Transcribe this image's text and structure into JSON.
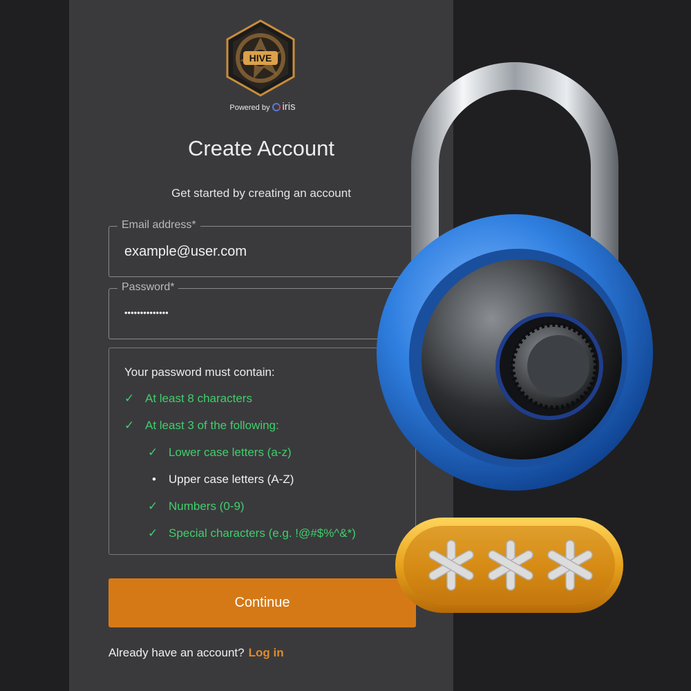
{
  "logo": {
    "text": "HIVE",
    "powered_by": "Powered by",
    "brand": "iris"
  },
  "header": {
    "title": "Create Account",
    "subtitle": "Get started by creating an account"
  },
  "form": {
    "email": {
      "label": "Email address*",
      "value": "example@user.com"
    },
    "password": {
      "label": "Password*",
      "value": "••••••••••••••"
    }
  },
  "requirements": {
    "heading": "Your password must contain:",
    "items": [
      {
        "mark": "✓",
        "text": "At least 8 characters",
        "met": true
      },
      {
        "mark": "✓",
        "text": "At least 3 of the following:",
        "met": true
      },
      {
        "mark": "✓",
        "text": "Lower case letters (a-z)",
        "met": true
      },
      {
        "mark": "•",
        "text": "Upper case letters (A-Z)",
        "met": false
      },
      {
        "mark": "✓",
        "text": "Numbers (0-9)",
        "met": true
      },
      {
        "mark": "✓",
        "text": "Special characters (e.g. !@#$%^&*)",
        "met": true
      }
    ]
  },
  "actions": {
    "continue_label": "Continue",
    "login_prompt": "Already have an account?",
    "login_link": "Log in"
  },
  "colors": {
    "accent": "#d57917",
    "success": "#3fcf6a",
    "panel": "#3a3a3d",
    "background": "#1f1f21",
    "lock_blue": "#2f7fe0",
    "pill_gold": "#e7a21c"
  },
  "decor": {
    "lock_icon": "padlock-icon",
    "password_pill_icon": "password-asterisks-icon"
  }
}
